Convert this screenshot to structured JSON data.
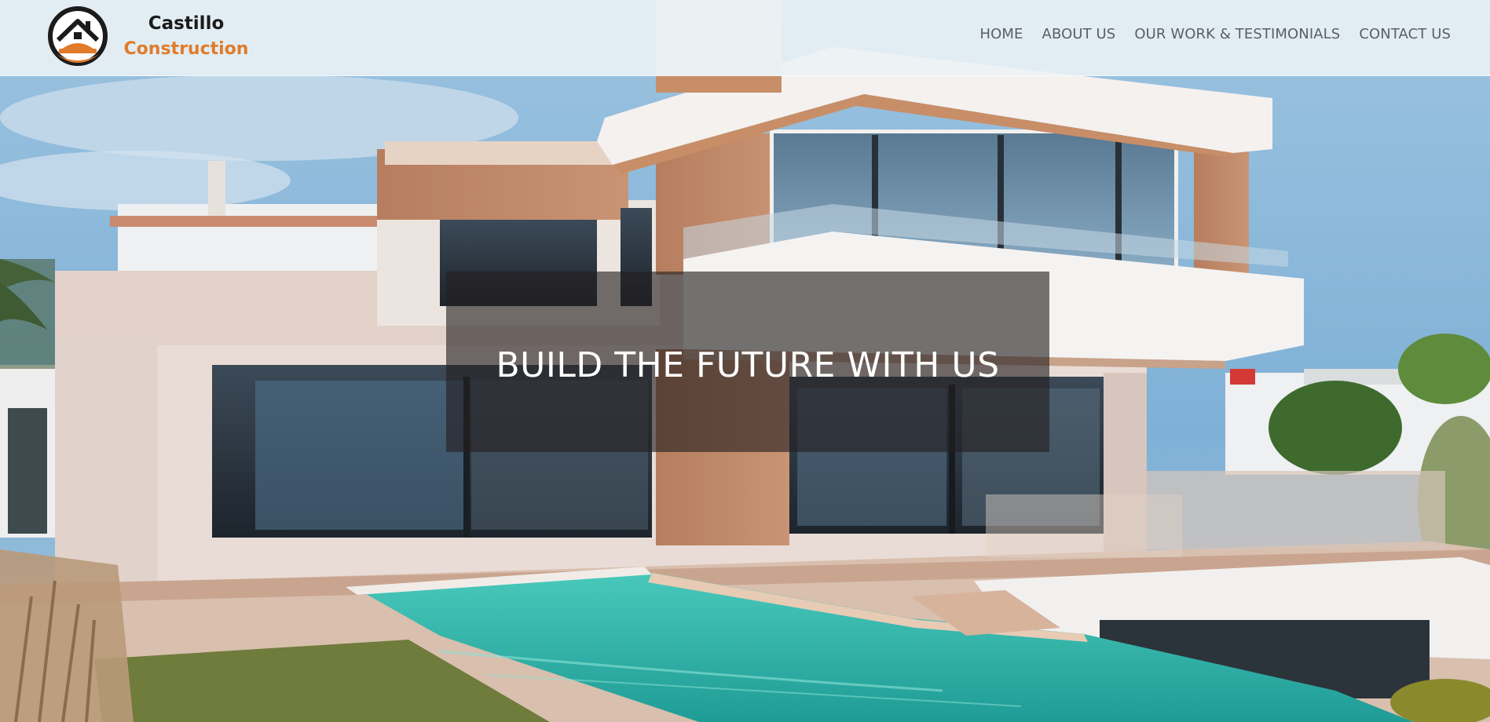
{
  "brand": {
    "name": "Castillo",
    "subtitle": "Construction",
    "logo_icon": "house-hardhat-logo-icon",
    "colors": {
      "name": "#1b1b1b",
      "subtitle": "#e07b2c"
    }
  },
  "nav": {
    "items": [
      {
        "label": "HOME"
      },
      {
        "label": "ABOUT US"
      },
      {
        "label": "OUR WORK & TESTIMONIALS"
      },
      {
        "label": "CONTACT US"
      }
    ]
  },
  "hero": {
    "title": "BUILD THE FUTURE WITH US"
  }
}
